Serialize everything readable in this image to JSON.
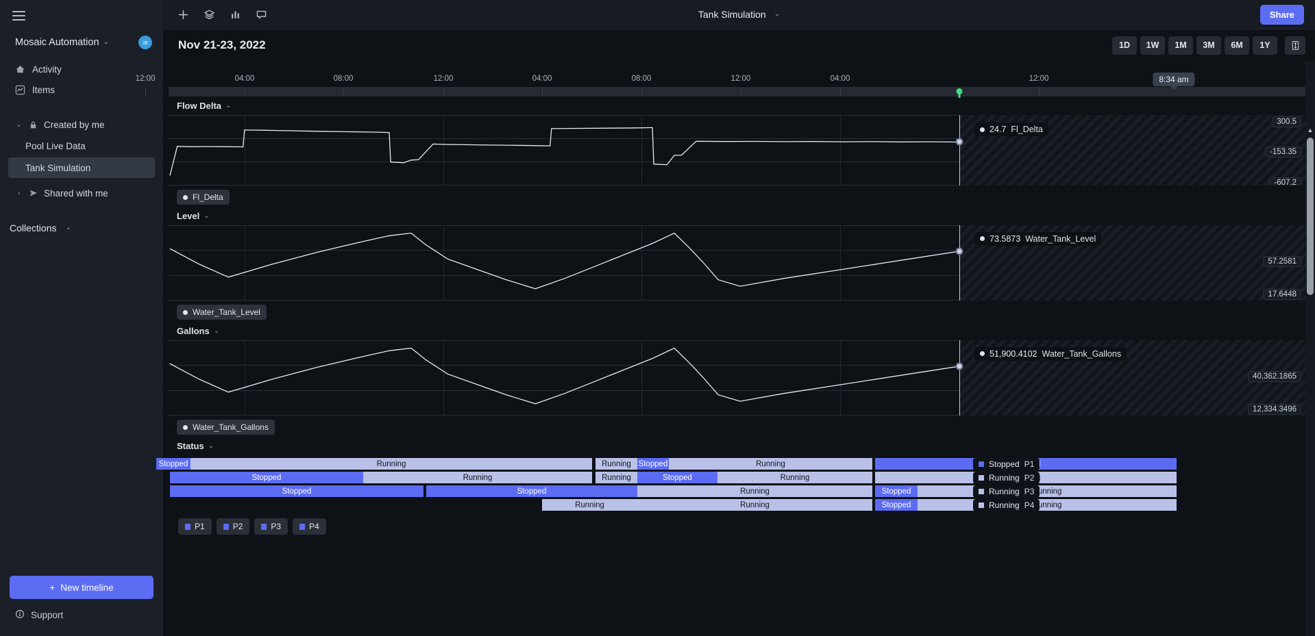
{
  "sidebar": {
    "hamburger": "menu-icon",
    "org": {
      "name": "Mosaic Automation",
      "chev": "⌄",
      "avatar_initials": "JE"
    },
    "nav": [
      {
        "label": "Activity",
        "icon": "home-icon"
      },
      {
        "label": "Items",
        "icon": "chart-line-icon"
      }
    ],
    "tree": [
      {
        "label": "Created by me",
        "twisty": "⌄",
        "icon": "lock-icon"
      }
    ],
    "children": [
      {
        "label": "Pool Live Data",
        "active": false
      },
      {
        "label": "Tank Simulation",
        "active": true
      }
    ],
    "shared": {
      "label": "Shared with me",
      "twisty": "›",
      "icon": "send-icon"
    },
    "collections": {
      "label": "Collections",
      "chev": "⌄"
    },
    "new_timeline": {
      "label": "New timeline",
      "icon": "plus-icon"
    },
    "support": {
      "label": "Support",
      "icon": "info-icon"
    }
  },
  "topbar": {
    "icons": [
      "plus-icon",
      "layers-icon",
      "bar-chart-icon",
      "comment-icon"
    ],
    "title": "Tank Simulation",
    "title_chev": "⌄",
    "share_label": "Share"
  },
  "header": {
    "date_range": "Nov 21-23, 2022",
    "ranges": [
      "1D",
      "1W",
      "1M",
      "3M",
      "6M",
      "1Y"
    ],
    "fit_icon": "fit-vertical-icon"
  },
  "timeline": {
    "ticks": [
      "12:00",
      "04:00",
      "08:00",
      "12:00",
      "04:00",
      "08:00",
      "12:00",
      "04:00",
      "12:00"
    ],
    "cursor_label": "8:34 am"
  },
  "chart_data": {
    "type": "line",
    "title": "Tank Simulation",
    "xlabel": "",
    "time_ticks": [
      "12:00",
      "04:00",
      "08:00",
      "12:00",
      "04:00",
      "08:00",
      "12:00",
      "04:00",
      "12:00"
    ],
    "cursor_time": "8:34 am",
    "panels": [
      {
        "title": "Flow Delta",
        "chev": "⌄",
        "series_chip": "Fl_Delta",
        "cursor_value": "24.7",
        "cursor_series": "Fl_Delta",
        "axis_labels": [
          "300.5",
          "-153.35",
          "-607.2"
        ],
        "ylim": [
          -607.2,
          300.5
        ],
        "ylabel": "",
        "points": [
          [
            0,
            -530
          ],
          [
            1,
            -95
          ],
          [
            3,
            -100
          ],
          [
            5,
            -98
          ],
          [
            8,
            -100
          ],
          [
            10,
            -102
          ],
          [
            10.2,
            150
          ],
          [
            12,
            148
          ],
          [
            16,
            140
          ],
          [
            20,
            132
          ],
          [
            24,
            124
          ],
          [
            28,
            118
          ],
          [
            30,
            112
          ],
          [
            30.2,
            -330
          ],
          [
            32,
            -340
          ],
          [
            33,
            -300
          ],
          [
            34,
            -295
          ],
          [
            36,
            -60
          ],
          [
            38,
            -66
          ],
          [
            42,
            -72
          ],
          [
            46,
            -78
          ],
          [
            50,
            -84
          ],
          [
            52,
            -88
          ],
          [
            52.2,
            170
          ],
          [
            56,
            175
          ],
          [
            60,
            178
          ],
          [
            64,
            182
          ],
          [
            66,
            186
          ],
          [
            66.2,
            -360
          ],
          [
            68,
            -370
          ],
          [
            69,
            -230
          ],
          [
            70,
            -225
          ],
          [
            72,
            -18
          ],
          [
            76,
            -22
          ],
          [
            80,
            -20
          ],
          [
            84,
            -24
          ],
          [
            88,
            -22
          ],
          [
            92,
            -26
          ],
          [
            96,
            -24
          ],
          [
            100,
            -28
          ],
          [
            104,
            -26
          ],
          [
            108,
            -30
          ]
        ]
      },
      {
        "title": "Level",
        "chev": "⌄",
        "series_chip": "Water_Tank_Level",
        "cursor_value": "73.5873",
        "cursor_series": "Water_Tank_Level",
        "axis_labels": [
          "57.2581",
          "17.6448"
        ],
        "ylim": [
          0,
          100
        ],
        "ylabel": "",
        "points": [
          [
            0,
            72
          ],
          [
            4,
            48
          ],
          [
            8,
            28
          ],
          [
            14,
            48
          ],
          [
            20,
            66
          ],
          [
            26,
            82
          ],
          [
            30,
            92
          ],
          [
            33,
            96
          ],
          [
            35,
            78
          ],
          [
            38,
            56
          ],
          [
            42,
            40
          ],
          [
            46,
            24
          ],
          [
            50,
            10
          ],
          [
            54,
            26
          ],
          [
            58,
            44
          ],
          [
            62,
            62
          ],
          [
            66,
            80
          ],
          [
            69,
            96
          ],
          [
            71,
            74
          ],
          [
            73,
            50
          ],
          [
            75,
            24
          ],
          [
            78,
            14
          ],
          [
            84,
            26
          ],
          [
            92,
            40
          ],
          [
            100,
            54
          ],
          [
            108,
            68
          ]
        ]
      },
      {
        "title": "Gallons",
        "chev": "⌄",
        "series_chip": "Water_Tank_Gallons",
        "cursor_value": "51,900.4102",
        "cursor_series": "Water_Tank_Gallons",
        "axis_labels": [
          "40,362.1865",
          "12,334.3496"
        ],
        "ylim": [
          0,
          100
        ],
        "ylabel": "",
        "points": [
          [
            0,
            72
          ],
          [
            4,
            48
          ],
          [
            8,
            28
          ],
          [
            14,
            48
          ],
          [
            20,
            66
          ],
          [
            26,
            82
          ],
          [
            30,
            92
          ],
          [
            33,
            96
          ],
          [
            35,
            78
          ],
          [
            38,
            56
          ],
          [
            42,
            40
          ],
          [
            46,
            24
          ],
          [
            50,
            10
          ],
          [
            54,
            26
          ],
          [
            58,
            44
          ],
          [
            62,
            62
          ],
          [
            66,
            80
          ],
          [
            69,
            96
          ],
          [
            71,
            74
          ],
          [
            73,
            50
          ],
          [
            75,
            24
          ],
          [
            78,
            14
          ],
          [
            84,
            26
          ],
          [
            92,
            40
          ],
          [
            100,
            54
          ],
          [
            108,
            68
          ]
        ]
      }
    ],
    "status": {
      "title": "Status",
      "chev": "⌄",
      "legend": [
        {
          "state": "Stopped",
          "process": "P1"
        },
        {
          "state": "Running",
          "process": "P2"
        },
        {
          "state": "Running",
          "process": "P3"
        },
        {
          "state": "Running",
          "process": "P4"
        }
      ],
      "rows": [
        [
          {
            "label": "Stopped",
            "state": "stopped",
            "start": -1.5,
            "end": 2.6
          },
          {
            "label": "Running",
            "state": "running",
            "start": 2.6,
            "end": 51.5
          },
          {
            "label": "Running",
            "state": "running",
            "start": 52.2,
            "end": 58.8
          },
          {
            "label": "Stopped",
            "state": "stopped",
            "start": 58.8,
            "end": 65.0
          },
          {
            "label": "Running",
            "state": "running",
            "start": 65.0,
            "end": 85.4
          },
          {
            "label": "Stopped",
            "state": "stopped",
            "start": 86.0,
            "end": 186.0
          }
        ],
        [
          {
            "label": "Stopped",
            "state": "stopped",
            "start": 0.3,
            "end": 16.5
          },
          {
            "label": "Running",
            "state": "running",
            "start": 16.5,
            "end": 51.5
          },
          {
            "label": "Running",
            "state": "running",
            "start": 52.2,
            "end": 58.8
          },
          {
            "label": "Stopped",
            "state": "stopped",
            "start": 58.8,
            "end": 65.0
          },
          {
            "label": "Running",
            "state": "running",
            "start": 65.0,
            "end": 85.4
          },
          {
            "label": "Running",
            "state": "running",
            "start": 86.0,
            "end": 186.0
          }
        ],
        [
          {
            "label": "Stopped",
            "state": "stopped",
            "start": 0.3,
            "end": 51.5
          },
          {
            "label": "Stopped",
            "state": "stopped",
            "start": 52.2,
            "end": 85.4
          },
          {
            "label": "Running",
            "state": "running",
            "start": 85.4,
            "end": 51.5
          },
          {
            "label": "Stopped",
            "state": "stopped",
            "start": 86.0,
            "end": 91.0
          },
          {
            "label": "Running",
            "state": "running",
            "start": 91.0,
            "end": 186.0
          }
        ],
        [
          {
            "label": "Running",
            "state": "running",
            "start": 85.4,
            "end": 51.5
          },
          {
            "label": "Stopped",
            "state": "stopped",
            "start": 86.0,
            "end": 91.0
          },
          {
            "label": "Running",
            "state": "running",
            "start": 91.0,
            "end": 186.0
          }
        ]
      ],
      "process_chips": [
        "P1",
        "P2",
        "P3",
        "P4"
      ]
    }
  },
  "colors": {
    "accent": "#5c6cf2",
    "running": "#b9c1e8",
    "stopped": "#5c6cf2",
    "cursor_green": "#3ee07f",
    "line": "#e8eaf2",
    "sidebar_bg": "#1b1f27",
    "main_bg": "#0e1116"
  }
}
